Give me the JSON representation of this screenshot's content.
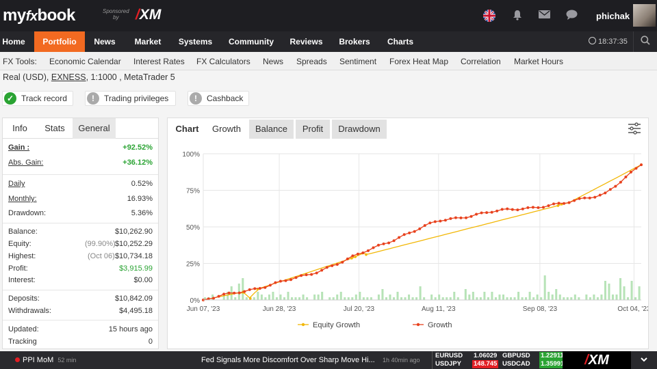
{
  "brand": {
    "logo_pre": "my",
    "logo_fx": "fx",
    "logo_post": "book",
    "sponsored_line1": "Sponsored",
    "sponsored_line2": "by",
    "sponsor_name": "XM"
  },
  "user": {
    "name": "phichak"
  },
  "icons": {
    "flag": "uk-flag-icon",
    "bell": "bell-icon",
    "mail": "mail-icon",
    "chat": "chat-icon",
    "search": "search-icon",
    "clock": "clock-icon",
    "settings": "settings-sliders-icon"
  },
  "nav": {
    "items": [
      "Home",
      "Portfolio",
      "News",
      "Market",
      "Systems",
      "Community",
      "Reviews",
      "Brokers",
      "Charts"
    ],
    "active": "Portfolio",
    "time": "18:37:35"
  },
  "subnav": {
    "label": "FX Tools:",
    "items": [
      "Economic Calendar",
      "Interest Rates",
      "FX Calculators",
      "News",
      "Spreads",
      "Sentiment",
      "Forex Heat Map",
      "Correlation",
      "Market Hours"
    ]
  },
  "account": {
    "type": "Real (USD),",
    "broker": "EXNESS",
    "rest": ", 1:1000 , MetaTrader 5"
  },
  "status": [
    {
      "label": "Track record",
      "state": "ok"
    },
    {
      "label": "Trading privileges",
      "state": "warn"
    },
    {
      "label": "Cashback",
      "state": "warn"
    }
  ],
  "left_tabs": [
    "Info",
    "Stats",
    "General"
  ],
  "stats": {
    "gain": {
      "label": "Gain :",
      "value": "+92.52%"
    },
    "abs_gain": {
      "label": "Abs. Gain:",
      "value": "+36.12%"
    },
    "daily": {
      "label": "Daily",
      "value": "0.52%"
    },
    "monthly": {
      "label": "Monthly:",
      "value": "16.93%"
    },
    "drawdown": {
      "label": "Drawdown:",
      "value": "5.36%"
    },
    "balance": {
      "label": "Balance:",
      "value": "$10,262.90"
    },
    "equity": {
      "label": "Equity:",
      "prefix": "(99.90%)",
      "value": "$10,252.29"
    },
    "highest": {
      "label": "Highest:",
      "prefix": "(Oct 06)",
      "value": "$10,734.18"
    },
    "profit": {
      "label": "Profit:",
      "value": "$3,915.99"
    },
    "interest": {
      "label": "Interest:",
      "value": "$0.00"
    },
    "deposits": {
      "label": "Deposits:",
      "value": "$10,842.09"
    },
    "withdrawals": {
      "label": "Withdrawals:",
      "value": "$4,495.18"
    },
    "updated": {
      "label": "Updated:",
      "value": "15 hours ago"
    },
    "tracking": {
      "label": "Tracking",
      "value": "0"
    }
  },
  "chart_tabs": [
    "Chart",
    "Growth",
    "Balance",
    "Profit",
    "Drawdown"
  ],
  "chart_data": {
    "type": "line",
    "x_ticks": [
      "Jun 07, '23",
      "Jun 28, '23",
      "Jul 20, '23",
      "Aug 11, '23",
      "Sep 08, '23",
      "Oct 04, '23"
    ],
    "y_ticks": [
      "0%",
      "25%",
      "50%",
      "75%",
      "100%"
    ],
    "ylim": [
      0,
      100
    ],
    "x_start": "2023-06-07",
    "x_end": "2023-10-06",
    "series": [
      {
        "name": "Growth",
        "color": "#e8421e",
        "x": [
          "2023-06-07",
          "2023-06-20",
          "2023-07-06",
          "2023-07-20",
          "2023-08-01",
          "2023-08-11",
          "2023-08-25",
          "2023-09-08",
          "2023-09-15",
          "2023-09-26",
          "2023-10-04",
          "2023-10-06"
        ],
        "values": [
          0,
          7,
          17,
          31,
          44,
          54,
          60,
          64,
          66,
          73,
          88,
          92.5
        ]
      },
      {
        "name": "Equity Growth",
        "color": "#f2b705",
        "x": [
          "2023-06-07",
          "2023-06-18",
          "2023-06-20",
          "2023-06-22",
          "2023-07-18",
          "2023-07-19",
          "2023-07-21",
          "2023-07-22",
          "2023-09-13",
          "2023-09-14",
          "2023-09-16",
          "2023-10-06"
        ],
        "values": [
          0,
          5.5,
          1,
          7.5,
          28.5,
          29.5,
          32,
          31,
          64.5,
          65.5,
          66.5,
          92.5
        ]
      }
    ],
    "bars": {
      "color": "#b7e3b7",
      "values": [
        1,
        1,
        2,
        0,
        0,
        2,
        3,
        5,
        1,
        6,
        8,
        1,
        1,
        1,
        3,
        2,
        1,
        2,
        3,
        1,
        2,
        1,
        3,
        1,
        1,
        1,
        2,
        1,
        0,
        2,
        2,
        3,
        0,
        1,
        1,
        2,
        3,
        1,
        1,
        1,
        2,
        3,
        1,
        1,
        1,
        0,
        2,
        4,
        1,
        2,
        1,
        3,
        1,
        1,
        2,
        1,
        1,
        5,
        1,
        0,
        2,
        1,
        2,
        1,
        1,
        1,
        3,
        1,
        0,
        4,
        2,
        3,
        1,
        1,
        3,
        1,
        3,
        1,
        2,
        2,
        1,
        1,
        1,
        3,
        1,
        1,
        3,
        1,
        2,
        1,
        9,
        3,
        2,
        4,
        2,
        1,
        1,
        1,
        2,
        1,
        0,
        2,
        1,
        2,
        1,
        2,
        7,
        6,
        2,
        2,
        8,
        5,
        1,
        7,
        1,
        5
      ]
    }
  },
  "legend": [
    "Equity Growth",
    "Growth"
  ],
  "ticker": {
    "event": "PPI MoM",
    "event_time": "52 min",
    "headline": "Fed Signals More Discomfort Over Sharp Move Hi...",
    "headline_time": "1h 40min ago",
    "fx": [
      {
        "pair": "EURUSD",
        "value": "1.06029",
        "state": "flat"
      },
      {
        "pair": "GBPUSD",
        "value": "1.22911",
        "state": "up"
      },
      {
        "pair": "USDJPY",
        "value": "148.745",
        "state": "down"
      },
      {
        "pair": "USDCAD",
        "value": "1.35991",
        "state": "up"
      }
    ],
    "xm": "XM"
  }
}
